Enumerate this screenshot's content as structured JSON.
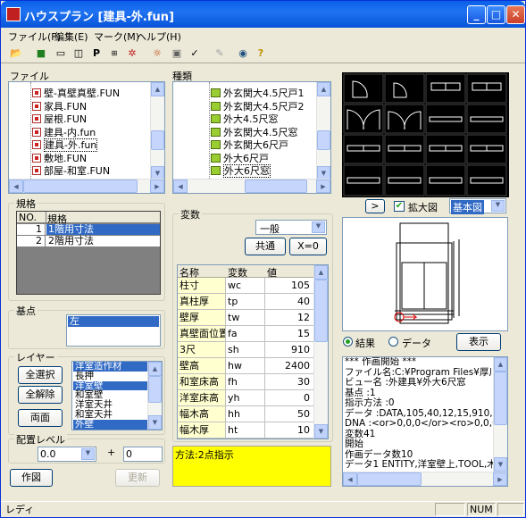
{
  "window": {
    "title": "ハウスプラン [建具-外.fun]"
  },
  "menu": [
    {
      "label": "ファイル(F)"
    },
    {
      "label": "編集(E)"
    },
    {
      "label": "マーク(M)"
    },
    {
      "label": "ヘルプ(H)"
    }
  ],
  "toolbar_icons": [
    "open-folder-icon",
    "cube-icon",
    "panel-icon",
    "split-panel-icon",
    "p-icon",
    "fuse-icon",
    "pattern-icon",
    "sun-icon",
    "paste-icon",
    "check-icon",
    "pen-icon",
    "globe-icon",
    "help-icon"
  ],
  "file_panel": {
    "label": "ファイル",
    "items": [
      "壁-真壁真壁.FUN",
      "家具.FUN",
      "屋根.FUN",
      "建具-内.fun",
      "建具-外.fun",
      "敷地.FUN",
      "部屋-和室.FUN",
      "部屋-天井.FUN"
    ],
    "selected_index": 4
  },
  "kind_panel": {
    "label": "種類",
    "items": [
      "外玄関大4.5尺戸1",
      "外玄関大4.5尺戸2",
      "外大4.5尺窓",
      "外玄関大4.5尺窓",
      "外玄関大6尺戸",
      "外大6尺戸",
      "外大6尺窓",
      "外大6尺窓"
    ],
    "selected_index": 6
  },
  "kikaku": {
    "label": "規格",
    "headers": [
      "NO.",
      "規格"
    ],
    "rows": [
      {
        "no": "1",
        "name": "1階用寸法"
      },
      {
        "no": "2",
        "name": "2階用寸法"
      }
    ],
    "selected_index": 0
  },
  "kiten": {
    "label": "基点",
    "items": [
      "左"
    ]
  },
  "layer": {
    "label": "レイヤー",
    "items": [
      "洋室造作材",
      "長押",
      "洋室壁",
      "和室壁",
      "洋室天井",
      "和室天井",
      "外壁"
    ],
    "selected": [
      0,
      2,
      6
    ],
    "buttons": {
      "select_all": "全選択",
      "deselect_all": "全解除",
      "both_sides": "両面"
    }
  },
  "placement": {
    "label": "配置レベル",
    "level_value": "0.0",
    "plus": "+",
    "offset_value": "0"
  },
  "bottom_buttons": {
    "draw": "作図",
    "update": "更新"
  },
  "variables": {
    "label": "変数",
    "combo_value": "一般",
    "common_button": "共通",
    "x0_button": "X=0",
    "headers": [
      "名称",
      "変数",
      "値"
    ],
    "rows": [
      {
        "name": "柱寸",
        "var": "wc",
        "value": "105"
      },
      {
        "name": "真柱厚",
        "var": "tp",
        "value": "40"
      },
      {
        "name": "壁厚",
        "var": "tw",
        "value": "12"
      },
      {
        "name": "真壁面位置",
        "var": "fa",
        "value": "15"
      },
      {
        "name": "3尺",
        "var": "sh",
        "value": "910"
      },
      {
        "name": "壁高",
        "var": "hw",
        "value": "2400"
      },
      {
        "name": "和室床高",
        "var": "fh",
        "value": "30"
      },
      {
        "name": "洋室床高",
        "var": "yh",
        "value": "0"
      },
      {
        "name": "幅木高",
        "var": "hh",
        "value": "50"
      },
      {
        "name": "幅木厚",
        "var": "ht",
        "value": "10"
      }
    ]
  },
  "method_text": "方法:2点指示",
  "preview": {
    "nav_button": ">",
    "zoom_checkbox_label": "拡大図",
    "zoom_checked": true,
    "view_combo_value": "基本図",
    "radio_result": "結果",
    "radio_data": "データ",
    "radio_selected": "result",
    "show_button": "表示"
  },
  "log_lines": [
    "*** 作画開始 ***",
    "ファイル名:C:¥Program Files¥厚川設",
    "ビュー名 :外建具¥外大6尺窓",
    "基点     :1",
    "指示方法 :0",
    "データ   :DATA,105,40,12,15,910,240",
    "DNA      :<or>0,0,0</or><ro>0,0,0</",
    "変数41",
    "開始",
    "作画データ数10",
    "データ1 ENTITY,洋室壁上,TOOL,木造"
  ],
  "status": {
    "text": "レディ",
    "num": "NUM"
  },
  "colors": {
    "selection": "#316AC5",
    "method_bg": "#FFFF00",
    "label_col": "#FFFFD0",
    "title_bar": "#0A5FE8"
  }
}
